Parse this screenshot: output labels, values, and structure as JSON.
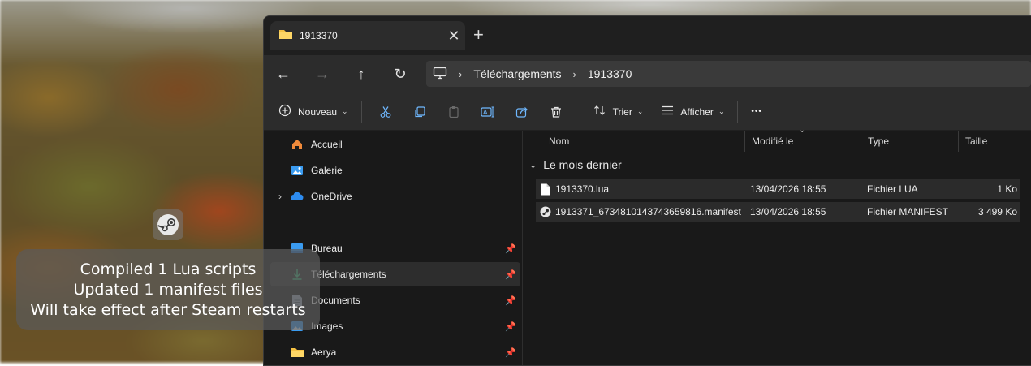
{
  "window": {
    "tab_title": "1913370",
    "close_glyph": "✕",
    "new_tab_glyph": "+"
  },
  "navigation": {
    "back_glyph": "←",
    "forward_glyph": "→",
    "up_glyph": "↑",
    "refresh_glyph": "↻",
    "breadcrumbs": [
      "Téléchargements",
      "1913370"
    ],
    "breadcrumb_separator": "›"
  },
  "toolbar": {
    "new_label": "Nouveau",
    "sort_label": "Trier",
    "view_label": "Afficher",
    "more_glyph": "•••"
  },
  "sidebar": {
    "items": [
      {
        "label": "Accueil",
        "icon": "home-icon"
      },
      {
        "label": "Galerie",
        "icon": "gallery-icon"
      },
      {
        "label": "OneDrive",
        "icon": "cloud-icon"
      },
      {
        "label": "Bureau",
        "icon": "desktop-icon"
      },
      {
        "label": "Téléchargements",
        "icon": "download-icon"
      },
      {
        "label": "Documents",
        "icon": "documents-icon"
      },
      {
        "label": "Images",
        "icon": "images-icon"
      },
      {
        "label": "Aerya",
        "icon": "folder-icon"
      }
    ]
  },
  "file_list": {
    "columns": [
      "Nom",
      "Modifié le",
      "Type",
      "Taille"
    ],
    "group_label": "Le mois dernier",
    "rows": [
      {
        "name": "1913370.lua",
        "modified": "13/04/2026 18:55",
        "type": "Fichier LUA",
        "size": "1 Ko",
        "icon": "file-icon"
      },
      {
        "name": "1913371_6734810143743659816.manifest",
        "modified": "13/04/2026 18:55",
        "type": "Fichier MANIFEST",
        "size": "3 499 Ko",
        "icon": "steam-icon"
      }
    ]
  },
  "notification": {
    "line1": "Compiled 1 Lua scripts",
    "line2": "Updated 1 manifest files",
    "line3": "Will take effect after Steam restarts"
  }
}
